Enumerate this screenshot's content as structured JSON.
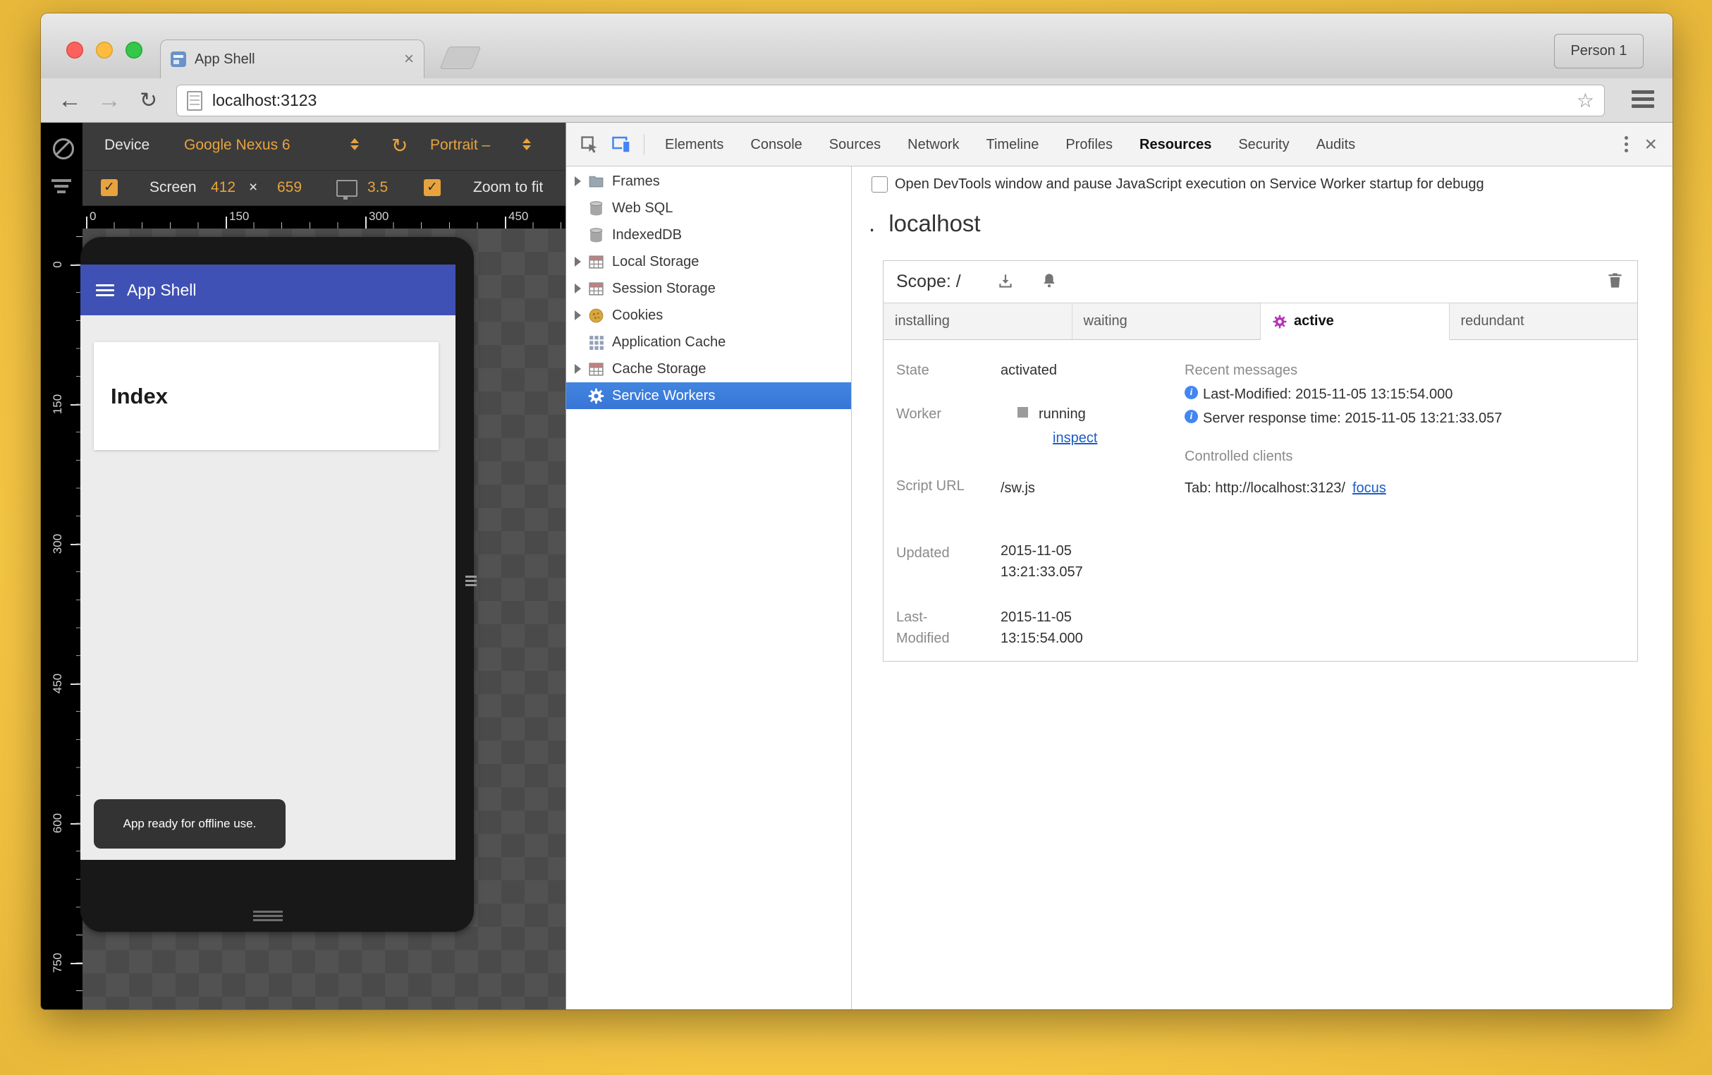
{
  "colors": {
    "desktop_yellow": "#F4C443",
    "app_bar_indigo": "#3F51B5",
    "emulation_accent_orange": "#E8A33E",
    "sidebar_selection_blue": "#3875D7",
    "active_worker_magenta": "#BB2FBB",
    "link_blue": "#1A5CC8",
    "info_blue": "#4285F4"
  },
  "icons": {
    "back": "←",
    "forward": "→",
    "reload": "↻",
    "star": "☆",
    "close": "×",
    "check": "✓"
  },
  "chrome": {
    "tab_title": "App Shell",
    "profile": "Person 1",
    "url": "localhost:3123"
  },
  "emulation": {
    "toolbar": {
      "device_label": "Device",
      "device_model": "Google Nexus 6",
      "orientation": "Portrait –",
      "screen_label": "Screen",
      "screen_width": "412",
      "times": "×",
      "screen_height": "659",
      "dpr": "3.5",
      "zoom_to_fit": "Zoom to fit"
    },
    "h_ruler": [
      "0",
      "150",
      "300",
      "450"
    ],
    "v_ruler": [
      "0",
      "150",
      "300",
      "450",
      "600",
      "750"
    ],
    "device": {
      "app_bar_title": "App Shell",
      "heading": "Index",
      "toast": "App ready for offline use."
    }
  },
  "devtools": {
    "tabs": [
      "Elements",
      "Console",
      "Sources",
      "Network",
      "Timeline",
      "Profiles",
      "Resources",
      "Security",
      "Audits"
    ],
    "sidebar": {
      "items": [
        "Frames",
        "Web SQL",
        "IndexedDB",
        "Local Storage",
        "Session Storage",
        "Cookies",
        "Application Cache",
        "Cache Storage",
        "Service Workers"
      ]
    },
    "sw_pane": {
      "pause_checkbox_label": "Open DevTools window and pause JavaScript execution on Service Worker startup for debugg",
      "origin_prefix": ".",
      "origin": "localhost",
      "scope_label": "Scope: /",
      "lifecycle": [
        "installing",
        "waiting",
        "active",
        "redundant"
      ],
      "state_label": "State",
      "state_value": "activated",
      "worker_label": "Worker",
      "worker_status": "running",
      "inspect_link": "inspect",
      "script_url_label": "Script URL",
      "script_url": "/sw.js",
      "updated_label": "Updated",
      "updated_value": "2015-11-05 13:21:33.057",
      "last_modified_label": "Last-Modified",
      "last_modified_value": "2015-11-05 13:15:54.000",
      "recent_messages_label": "Recent messages",
      "messages": [
        "Last-Modified: 2015-11-05 13:15:54.000",
        "Server response time: 2015-11-05 13:21:33.057"
      ],
      "controlled_clients_label": "Controlled clients",
      "client_tab": "Tab: http://localhost:3123/",
      "focus_link": "focus"
    }
  }
}
